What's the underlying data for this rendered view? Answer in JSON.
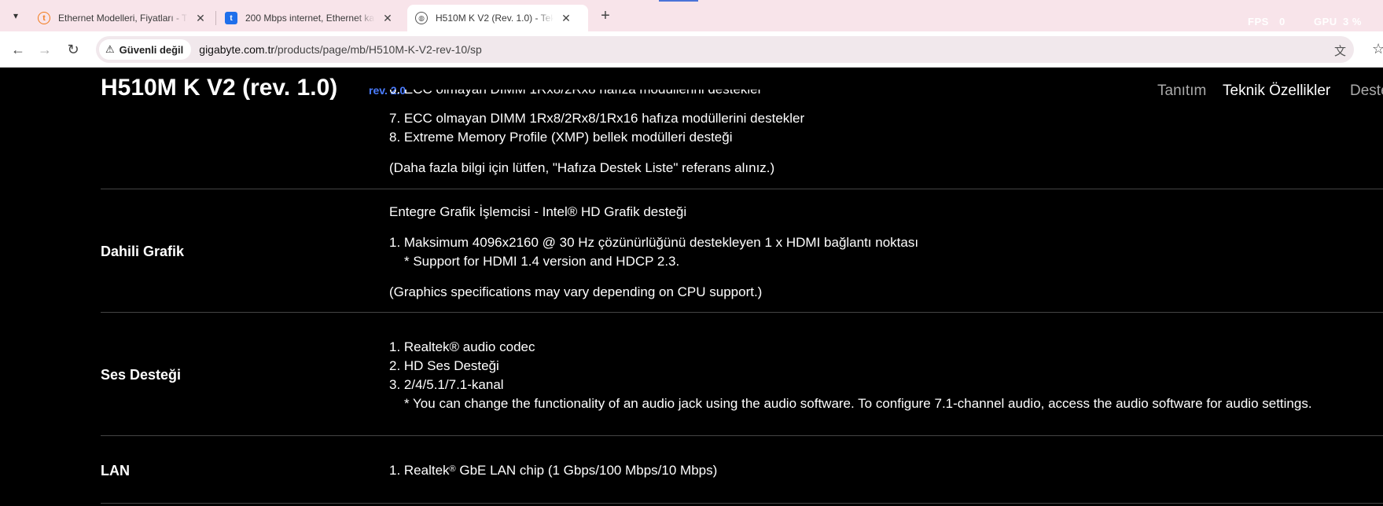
{
  "browser": {
    "tabs": [
      {
        "title": "Ethernet Modelleri, Fiyatları - Tr",
        "favicon": "trendyol-icon",
        "favicon_color": "#f27a1a"
      },
      {
        "title": "200 Mbps internet, Ethernet kat",
        "favicon": "t-icon",
        "favicon_color": "#1f6feb"
      },
      {
        "title": "H510M K V2 (Rev. 1.0) - Teknik Ö",
        "favicon": "globe-icon",
        "favicon_color": "#555555"
      }
    ],
    "fps_label": "FPS",
    "fps_value": "0",
    "gpu_label": "GPU",
    "gpu_value": "3 %",
    "security_label": "Güvenli değil",
    "url_domain": "gigabyte.com.tr",
    "url_path": "/products/page/mb/H510M-K-V2-rev-10/sp"
  },
  "product": {
    "title": "H510M K V2  (rev. 1.0)",
    "rev_link": "rev. 2.0",
    "nav": [
      "Tanıtım",
      "Teknik Özellikler",
      "Deste"
    ]
  },
  "specs": {
    "memory": {
      "partial_line": "6. ECC olmayan DIMM 1Rx8/2Rx8 hafıza modüllerini destekler",
      "lines": [
        "7. ECC olmayan DIMM 1Rx8/2Rx8/1Rx16 hafıza modüllerini destekler",
        "8. Extreme Memory Profile (XMP) bellek modülleri desteği"
      ],
      "note": "(Daha fazla bilgi için lütfen, \"Hafıza Destek Liste\" referans alınız.)"
    },
    "graphics": {
      "label": "Dahili Grafik",
      "intro": "Entegre Grafik İşlemcisi - Intel® HD Grafik desteği",
      "line1": "1. Maksimum 4096x2160 @ 30 Hz çözünürlüğünü destekleyen 1 x HDMI bağlantı noktası",
      "line1_sub": "* Support for HDMI 1.4 version and HDCP 2.3.",
      "note": "(Graphics specifications may vary depending on CPU support.)"
    },
    "audio": {
      "label": "Ses Desteği",
      "lines": [
        "1. Realtek® audio codec",
        "2. HD Ses Desteği",
        "3. 2/4/5.1/7.1-kanal"
      ],
      "sub": "* You can change the functionality of an audio jack using the audio software. To configure 7.1-channel audio, access the audio software for audio settings."
    },
    "lan": {
      "label": "LAN",
      "prefix": "1. Realtek",
      "reg": "®",
      "suffix": " GbE LAN chip (1 Gbps/100 Mbps/10 Mbps)"
    }
  }
}
